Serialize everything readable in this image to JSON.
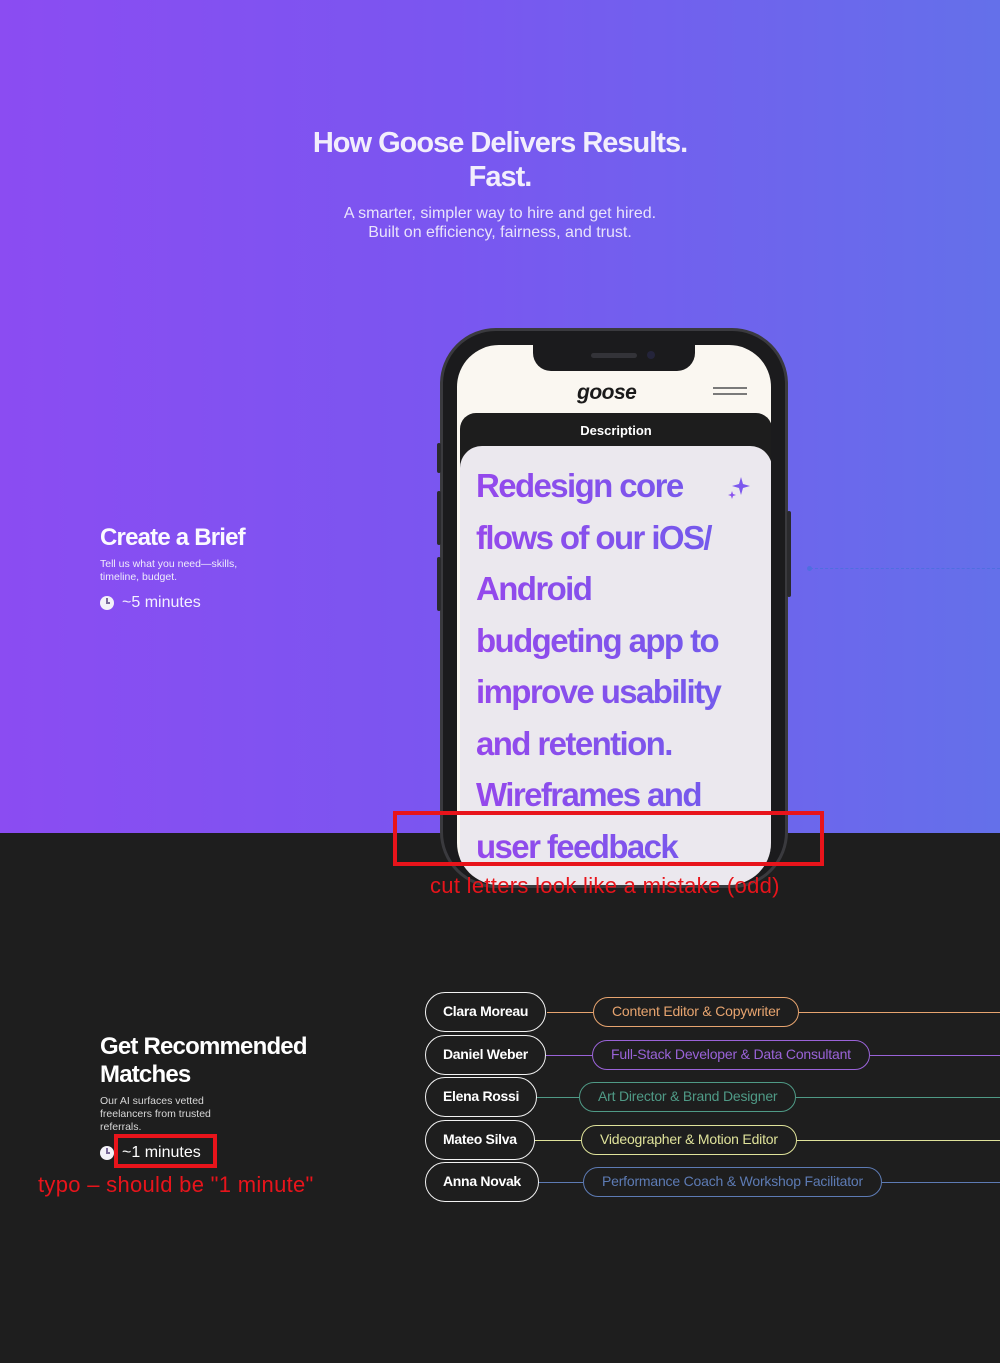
{
  "hero": {
    "title_line1": "How Goose Delivers Results.",
    "title_line2": "Fast.",
    "subtitle_line1": "A smarter, simpler way to hire and get hired.",
    "subtitle_line2": "Built on efficiency, fairness, and trust."
  },
  "steps": [
    {
      "title": "Create a Brief",
      "desc_line1": "Tell us what you need—skills,",
      "desc_line2": "timeline, budget.",
      "time": "~5 minutes"
    },
    {
      "title_line1": "Get Recommended",
      "title_line2": "Matches",
      "desc_line1": "Our AI surfaces vetted",
      "desc_line2": "freelancers from trusted",
      "desc_line3": "referrals.",
      "time": "~1 minutes"
    }
  ],
  "phone": {
    "logo": "goose",
    "card_label": "Description",
    "description_lines": [
      "Redesign core",
      "flows of our iOS/",
      "Android",
      "budgeting app to",
      "improve usability",
      "and retention.",
      "Wireframes and",
      "user feedback"
    ]
  },
  "matches": [
    {
      "name": "Clara Moreau",
      "role": "Content Editor & Copywriter",
      "color": "#e7a46f"
    },
    {
      "name": "Daniel Weber",
      "role": "Full-Stack Developer & Data Consultant",
      "color": "#9a63d8"
    },
    {
      "name": "Elena Rossi",
      "role": "Art Director & Brand Designer",
      "color": "#4f9a86"
    },
    {
      "name": "Mateo Silva",
      "role": "Videographer & Motion Editor",
      "color": "#dfe29a"
    },
    {
      "name": "Anna Novak",
      "role": "Performance Coach & Workshop Facilitator",
      "color": "#5d7bb4"
    }
  ],
  "annotations": {
    "cut_letters": "cut letters look like a mistake (odd)",
    "typo": "typo – should be \"1 minute\""
  },
  "colors": {
    "annotation": "#e8141b",
    "gradient_start": "#8b4cf2",
    "gradient_end": "#6470ea",
    "dark_bg": "#1e1e1e"
  },
  "icons": [
    "clock-icon",
    "sparkle-icon",
    "hamburger-menu-icon"
  ]
}
